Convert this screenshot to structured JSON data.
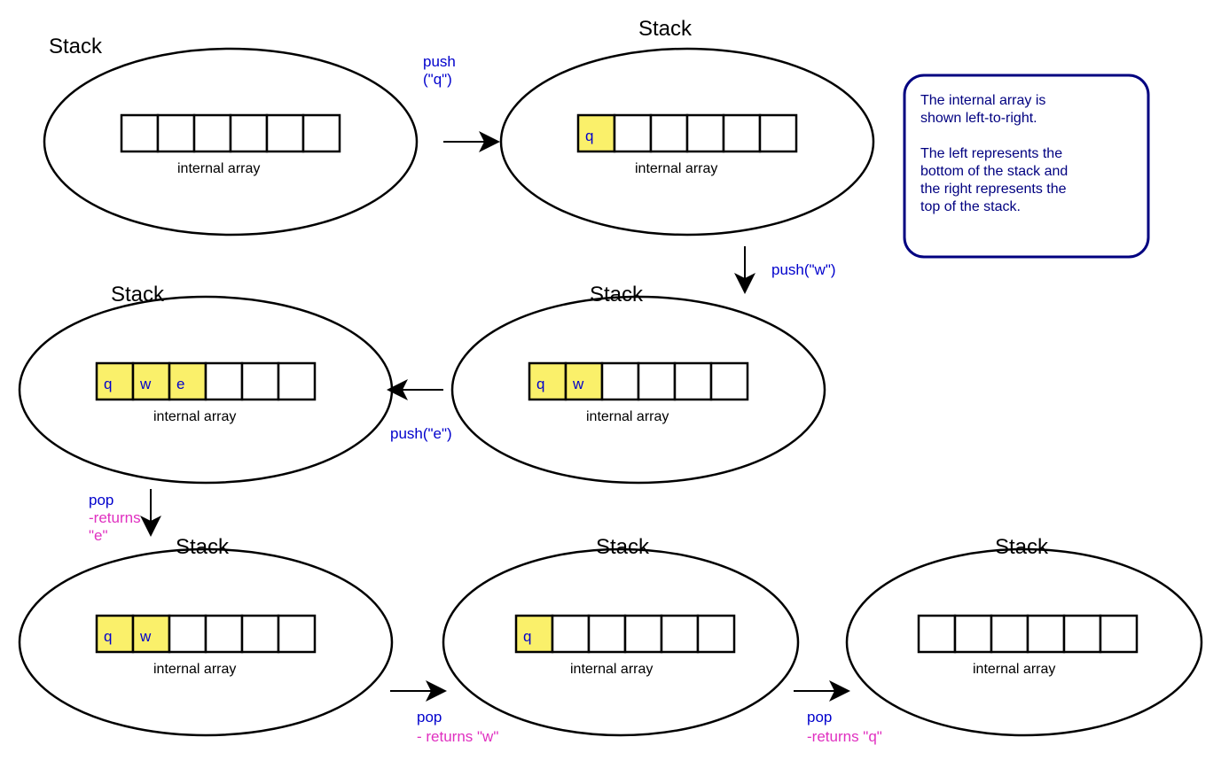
{
  "stack_title": "Stack",
  "array_caption": "internal array",
  "cell_count": 6,
  "stacks": {
    "s1": {
      "filled": [],
      "letters": []
    },
    "s2": {
      "filled": [
        "q"
      ],
      "letters": [
        "q"
      ]
    },
    "s3": {
      "filled": [
        "q",
        "w"
      ],
      "letters": [
        "q",
        "w"
      ]
    },
    "s4": {
      "filled": [
        "q",
        "w",
        "e"
      ],
      "letters": [
        "q",
        "w",
        "e"
      ]
    },
    "s5": {
      "filled": [
        "q",
        "w"
      ],
      "letters": [
        "q",
        "w"
      ]
    },
    "s6": {
      "filled": [
        "q"
      ],
      "letters": [
        "q"
      ]
    },
    "s7": {
      "filled": [],
      "letters": []
    }
  },
  "ops": {
    "a1": {
      "op_line1": "push",
      "op_line2": "(\"q\")",
      "ret": ""
    },
    "a2": {
      "op_line1": "push(\"w\")",
      "op_line2": "",
      "ret": ""
    },
    "a3": {
      "op_line1": "push(\"e\")",
      "op_line2": "",
      "ret": ""
    },
    "a4": {
      "op_line1": "pop",
      "op_line2": "",
      "ret_line1": "-returns",
      "ret_line2": "\"e\""
    },
    "a5": {
      "op_line1": "pop",
      "op_line2": "",
      "ret": "- returns \"w\""
    },
    "a6": {
      "op_line1": "pop",
      "op_line2": "",
      "ret": "-returns \"q\""
    }
  },
  "note": {
    "line1": "The internal array is",
    "line2": "shown left-to-right.",
    "line3": "",
    "line4": "The left represents the",
    "line5": "bottom of the stack and",
    "line6": "the right represents the",
    "line7": "top of the stack."
  }
}
